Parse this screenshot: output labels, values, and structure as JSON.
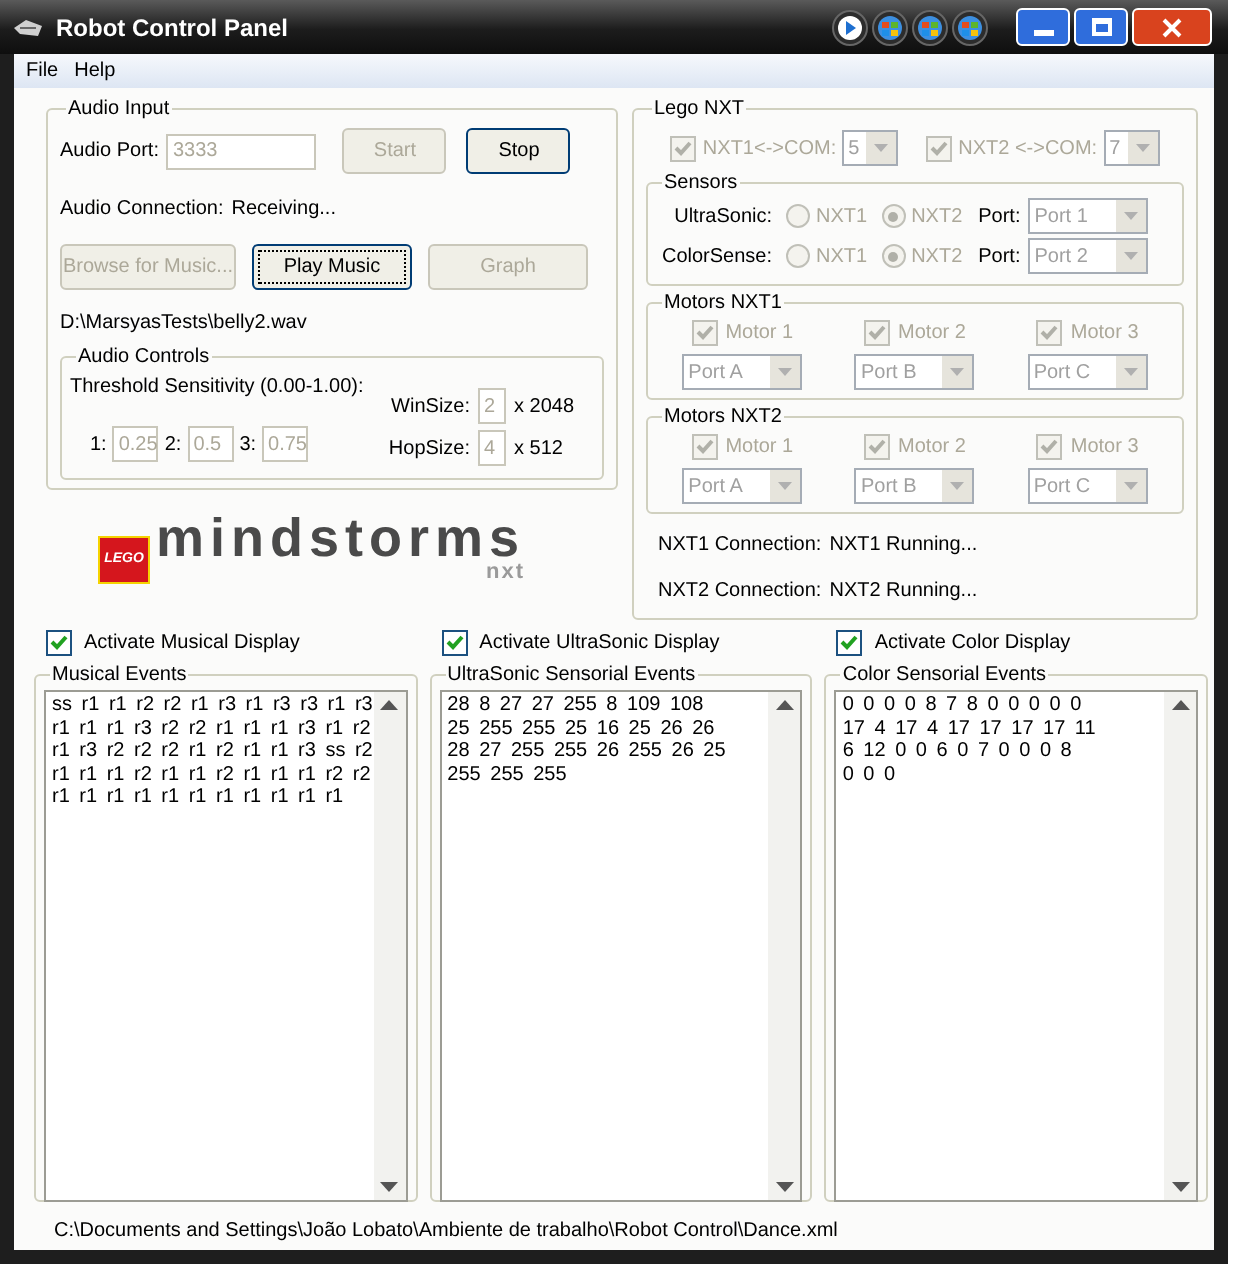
{
  "window": {
    "title": "Robot Control Panel"
  },
  "menu": [
    {
      "label": "File"
    },
    {
      "label": "Help"
    }
  ],
  "audio_input": {
    "title": "Audio Input",
    "port_label": "Audio Port:",
    "port_value": "3333",
    "port_disabled": true,
    "top_buttons": [
      {
        "label": "Start",
        "disabled": true,
        "focused": false
      },
      {
        "label": "Stop",
        "disabled": false,
        "focused": false
      }
    ],
    "connection_label": "Audio Connection:",
    "connection_value": "Receiving...",
    "buttons": [
      {
        "label": "Browse for Music...",
        "disabled": true,
        "focused": false
      },
      {
        "label": "Play Music",
        "disabled": false,
        "focused": true
      },
      {
        "label": "Graph",
        "disabled": true,
        "focused": false
      }
    ],
    "file_path": "D:\\MarsyasTests\\belly2.wav",
    "audio_controls": {
      "title": "Audio Controls",
      "threshold_label": "Threshold Sensitivity (0.00-1.00):",
      "thresholds": [
        {
          "label": "1:",
          "value": "0.25"
        },
        {
          "label": "2:",
          "value": "0.5"
        },
        {
          "label": "3:",
          "value": "0.75"
        }
      ],
      "sizes": [
        {
          "label": "WinSize:",
          "value": "2",
          "suffix": "x 2048"
        },
        {
          "label": "HopSize:",
          "value": "4",
          "suffix": "x 512"
        }
      ]
    }
  },
  "logo": {
    "brand": "LEGO",
    "name": "mindstorms",
    "sub": "nxt"
  },
  "lego_nxt": {
    "title": "Lego NXT",
    "disabled": true,
    "com": [
      {
        "label": "NXT1<->COM:",
        "checked": true,
        "value": "5"
      },
      {
        "label": "NXT2 <->COM:",
        "checked": true,
        "value": "7"
      }
    ],
    "sensors": {
      "title": "Sensors",
      "rows": [
        {
          "label": "UltraSonic:",
          "options": [
            {
              "label": "NXT1",
              "selected": false
            },
            {
              "label": "NXT2",
              "selected": true
            }
          ],
          "port_label": "Port:",
          "port_value": "Port 1"
        },
        {
          "label": "ColorSense:",
          "options": [
            {
              "label": "NXT1",
              "selected": false
            },
            {
              "label": "NXT2",
              "selected": true
            }
          ],
          "port_label": "Port:",
          "port_value": "Port 2"
        }
      ]
    },
    "motor_groups": [
      {
        "title": "Motors NXT1",
        "motors": [
          {
            "label": "Motor 1",
            "checked": true,
            "port": "Port A"
          },
          {
            "label": "Motor 2",
            "checked": true,
            "port": "Port B"
          },
          {
            "label": "Motor 3",
            "checked": true,
            "port": "Port C"
          }
        ]
      },
      {
        "title": "Motors NXT2",
        "motors": [
          {
            "label": "Motor 1",
            "checked": true,
            "port": "Port A"
          },
          {
            "label": "Motor 2",
            "checked": true,
            "port": "Port B"
          },
          {
            "label": "Motor 3",
            "checked": true,
            "port": "Port C"
          }
        ]
      }
    ],
    "status": [
      {
        "label": "NXT1 Connection:",
        "value": "NXT1 Running..."
      },
      {
        "label": "NXT2 Connection:",
        "value": "NXT2 Running..."
      }
    ]
  },
  "displays": [
    {
      "toggle": "Activate Musical Display",
      "checked": true,
      "title": "Musical Events",
      "lines": [
        "ss r1 r1 r2 r2 r1 r3 r1 r3 r3 r1 r3",
        "r1 r1 r1 r3 r2 r2 r1 r1 r1 r3 r1 r2",
        "r1 r3 r2 r2 r2 r1 r2 r1 r1 r3 ss r2",
        "r1 r1 r1 r2 r1 r1 r2 r1 r1 r1 r2 r2",
        "r1 r1 r1 r1 r1 r1 r1 r1 r1 r1 r1"
      ]
    },
    {
      "toggle": "Activate UltraSonic Display",
      "checked": true,
      "title": "UltraSonic Sensorial Events",
      "lines": [
        "28 8 27 27 255 8 109 108",
        "25 255 255 25 16 25 26 26",
        "28 27 255 255 26 255 26 25",
        "255 255 255"
      ]
    },
    {
      "toggle": "Activate Color Display",
      "checked": true,
      "title": "Color Sensorial Events",
      "lines": [
        "0 0 0 0 8 7 8 0 0 0 0 0",
        "17 4 17 4 17 17 17 17 11",
        "6 12 0 0 6 0 7 0 0 0 8",
        "0 0 0"
      ]
    }
  ],
  "status_bar": {
    "path": "C:\\Documents and Settings\\João Lobato\\Ambiente de trabalho\\Robot Control\\Dance.xml"
  }
}
